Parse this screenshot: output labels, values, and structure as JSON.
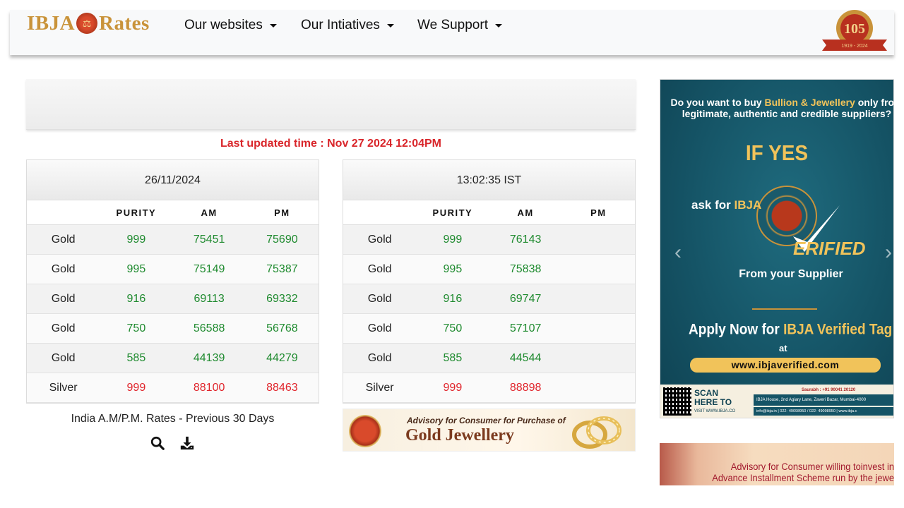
{
  "nav": {
    "logo_left": "IBJA",
    "logo_right": "Rates",
    "items": [
      {
        "label": "Our websites"
      },
      {
        "label": "Our Intiatives"
      },
      {
        "label": "We Support"
      }
    ],
    "badge": {
      "number": "105",
      "years": "1919 - 2024"
    }
  },
  "updated_text": "Last updated time : Nov 27 2024 12:04PM",
  "table_left": {
    "header": "26/11/2024",
    "columns": [
      "",
      "PURITY",
      "AM",
      "PM"
    ],
    "rows": [
      {
        "metal": "Gold",
        "purity": "999",
        "am": "75451",
        "pm": "75690",
        "color": "green"
      },
      {
        "metal": "Gold",
        "purity": "995",
        "am": "75149",
        "pm": "75387",
        "color": "green"
      },
      {
        "metal": "Gold",
        "purity": "916",
        "am": "69113",
        "pm": "69332",
        "color": "green"
      },
      {
        "metal": "Gold",
        "purity": "750",
        "am": "56588",
        "pm": "56768",
        "color": "green"
      },
      {
        "metal": "Gold",
        "purity": "585",
        "am": "44139",
        "pm": "44279",
        "color": "green"
      },
      {
        "metal": "Silver",
        "purity": "999",
        "am": "88100",
        "pm": "88463",
        "color": "red"
      }
    ]
  },
  "table_right": {
    "header": "13:02:35 IST",
    "columns": [
      "",
      "PURITY",
      "AM",
      "PM"
    ],
    "rows": [
      {
        "metal": "Gold",
        "purity": "999",
        "am": "76143",
        "pm": "",
        "color": "green"
      },
      {
        "metal": "Gold",
        "purity": "995",
        "am": "75838",
        "pm": "",
        "color": "green"
      },
      {
        "metal": "Gold",
        "purity": "916",
        "am": "69747",
        "pm": "",
        "color": "green"
      },
      {
        "metal": "Gold",
        "purity": "750",
        "am": "57107",
        "pm": "",
        "color": "green"
      },
      {
        "metal": "Gold",
        "purity": "585",
        "am": "44544",
        "pm": "",
        "color": "green"
      },
      {
        "metal": "Silver",
        "purity": "999",
        "am": "88898",
        "pm": "",
        "color": "red"
      }
    ]
  },
  "previous_30_days": "India A.M/P.M. Rates - Previous 30 Days",
  "icons": {
    "search": "search-icon",
    "download": "download-icon"
  },
  "advisory_banner": {
    "line1": "Advisory for Consumer for Purchase of",
    "line2": "Gold Jewellery"
  },
  "side_ad": {
    "question_pre": "Do you want to buy ",
    "question_gold": "Bullion & Jewellery",
    "question_post": " only from legitimate, authentic and credible suppliers?",
    "if_yes": "IF YES",
    "ask_pre": "ask for ",
    "ask_gold": "IBJA",
    "verified": "ERIFIED",
    "from_supplier": "From your Supplier",
    "apply_pre": "Apply Now for ",
    "apply_gold": "IBJA Verified Tag",
    "at": "at",
    "url": "www.ibjaverified.com",
    "scan_line1": "SCAN",
    "scan_line2": "HERE TO",
    "scan_sub": "VISIT WWW.IBJA.CO",
    "contact_name": "Saurabh : +91 90041 20120",
    "address": "IBJA House, 2nd Agiary Lane, Zaveri Bazar, Mumbai-4000",
    "contact_line": "info@ibja.in  |  022- 49098950 / 022- 49098950  |  www.ibja.c"
  },
  "second_ad": {
    "line1": "Advisory for Consumer willing toinvest in",
    "line2": "Advance Installment Scheme run by the jewe"
  }
}
